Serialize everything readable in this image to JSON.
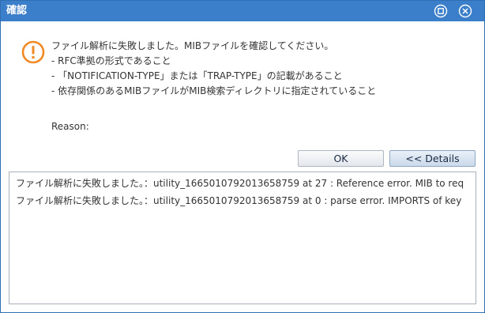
{
  "window": {
    "title": "確認",
    "maximize_icon": "maximize-icon",
    "close_icon": "close-icon"
  },
  "message": {
    "icon": "warning-icon",
    "accent_color": "#f08a24",
    "lines": [
      "ファイル解析に失敗しました。MIBファイルを確認してください。",
      "- RFC準拠の形式であること",
      "- 「NOTIFICATION-TYPE」または「TRAP-TYPE」の記載があること",
      "- 依存関係のあるMIBファイルがMIB検索ディレクトリに指定されていること"
    ],
    "reason_label": "Reason:"
  },
  "buttons": {
    "ok_label": "OK",
    "details_label": "<< Details"
  },
  "details": {
    "lines": [
      "ファイル解析に失敗しました。：utility_1665010792013658759 at 27 : Reference error. MIB to req",
      "ファイル解析に失敗しました。：utility_1665010792013658759 at 0 : parse error. IMPORTS of key"
    ]
  },
  "colors": {
    "titlebar": "#3b7ec9",
    "title_text": "#ffffff"
  }
}
